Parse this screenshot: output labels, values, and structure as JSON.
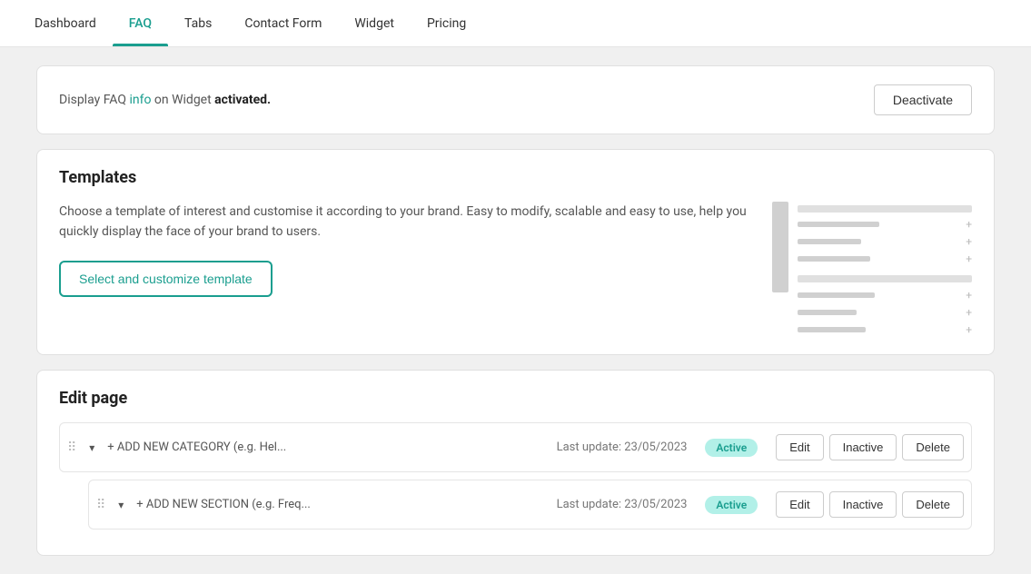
{
  "nav": {
    "items": [
      {
        "label": "Dashboard",
        "active": false
      },
      {
        "label": "FAQ",
        "active": true
      },
      {
        "label": "Tabs",
        "active": false
      },
      {
        "label": "Contact Form",
        "active": false
      },
      {
        "label": "Widget",
        "active": false
      },
      {
        "label": "Pricing",
        "active": false
      }
    ]
  },
  "activation_bar": {
    "text_prefix": "Display FAQ info on Widget ",
    "text_highlight": "info",
    "text_suffix": " on Widget ",
    "full_text": "Display FAQ info on Widget activated.",
    "status_bold": "activated.",
    "deactivate_label": "Deactivate"
  },
  "templates": {
    "title": "Templates",
    "description": "Choose a template of interest and customise it according to your brand. Easy to modify, scalable and easy to use, help you quickly display the face of your brand to users.",
    "button_label": "Select and customize template"
  },
  "edit_page": {
    "title": "Edit page",
    "rows": [
      {
        "drag": "⠿",
        "label": "+ ADD NEW CATEGORY (e.g. Hel...",
        "last_update": "Last update: 23/05/2023",
        "status": "Active",
        "edit_label": "Edit",
        "inactive_label": "Inactive",
        "delete_label": "Delete"
      },
      {
        "drag": "⠿",
        "label": "+ ADD NEW SECTION (e.g. Freq...",
        "last_update": "Last update: 23/05/2023",
        "status": "Active",
        "edit_label": "Edit",
        "inactive_label": "Inactive",
        "delete_label": "Delete"
      }
    ]
  }
}
